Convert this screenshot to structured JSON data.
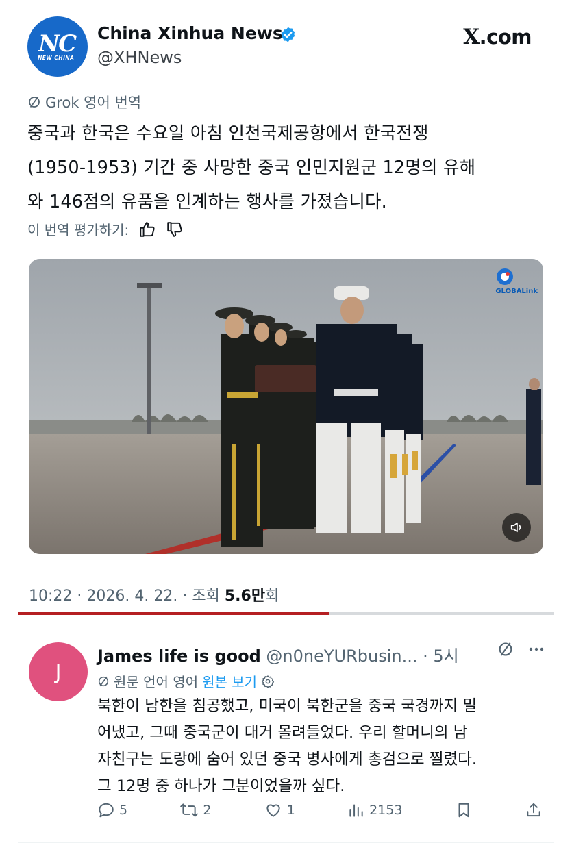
{
  "post": {
    "author_name": "China Xinhua News",
    "author_handle": "@XHNews",
    "avatar_text": "NC",
    "avatar_subtext": "NEW CHINA",
    "site": "X.com",
    "translation_label": "Grok 영어 번역",
    "text_lines": [
      "중국과 한국은 수요일 아침 인천국제공항에서 한국전쟁",
      "(1950-1953) 기간 중 사망한 중국 인민지원군 12명의 유해",
      "와 146점의 유품을 인계하는 행사를 가졌습니다."
    ],
    "rate_label": "이 번역 평가하기:",
    "media_watermark": "GLOBALink",
    "time": "10:22",
    "date": "2026. 4. 22.",
    "views_label": "조회",
    "views_count": "5.6만",
    "views_suffix": "회",
    "video_progress": 0.58
  },
  "reply": {
    "avatar_letter": "J",
    "name": "James life is good",
    "handle": "@n0neYURbusin...",
    "age": "· 5시",
    "source_label": "원문 언어 영어",
    "view_original": "원본 보기",
    "text_lines": [
      "북한이 남한을 침공했고, 미국이 북한군을 중국 국경까지 밀",
      "어냈고, 그때 중국군이 대거 몰려들었다. 우리 할머니의 남",
      "자친구는 도랑에 숨어 있던 중국 병사에게 총검으로 찔렸다.",
      "그 12명 중 하나가 그분이었을까 싶다."
    ],
    "stats": {
      "replies": "5",
      "reposts": "2",
      "likes": "1",
      "views": "2153"
    }
  },
  "colors": {
    "accent": "#1d9bf0",
    "progress": "#b51f22",
    "avatar_xh": "#1769c9",
    "avatar_reply": "#e0517e"
  }
}
